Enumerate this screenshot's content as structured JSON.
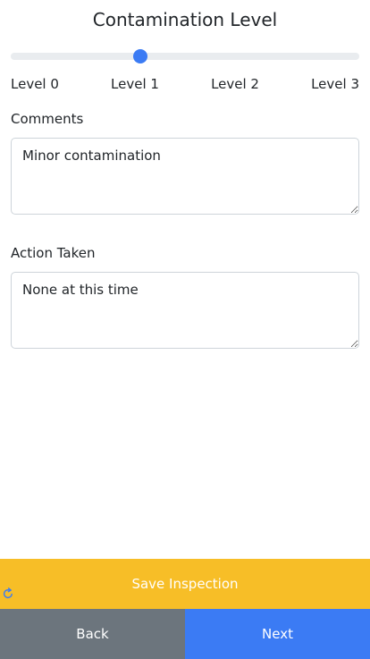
{
  "header": {
    "title": "Contamination Level"
  },
  "contamination_slider": {
    "value": 1,
    "min": 0,
    "max": 3,
    "tick_labels": [
      "Level 0",
      "Level 1",
      "Level 2",
      "Level 3"
    ],
    "accent_color": "#3b7bf4"
  },
  "comments": {
    "label": "Comments",
    "value": "Minor contamination"
  },
  "action_taken": {
    "label": "Action Taken",
    "value": "None at this time"
  },
  "footer": {
    "save_label": "Save Inspection",
    "save_color": "#f7be27",
    "refresh_icon": "refresh-icon",
    "back_label": "Back",
    "back_color": "#6c757d",
    "next_label": "Next",
    "next_color": "#3b7bf4"
  }
}
